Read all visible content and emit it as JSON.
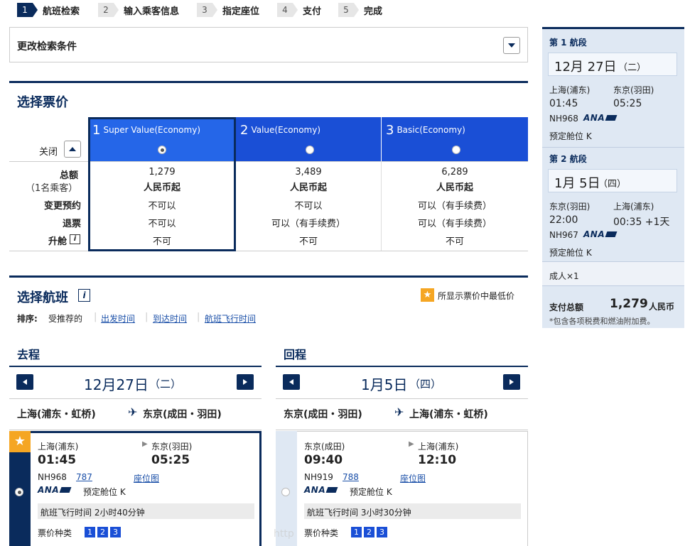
{
  "steps": [
    {
      "num": "1",
      "label": "航班检索"
    },
    {
      "num": "2",
      "label": "输入乘客信息"
    },
    {
      "num": "3",
      "label": "指定座位"
    },
    {
      "num": "4",
      "label": "支付"
    },
    {
      "num": "5",
      "label": "完成"
    }
  ],
  "modify": {
    "label": "更改检索条件"
  },
  "fare": {
    "title": "选择票价",
    "close_label": "关闭",
    "columns": [
      {
        "num": "1",
        "name": "Super Value(Economy)",
        "total": "1,279",
        "unit": "人民币起",
        "change": "不可以",
        "refund": "不可以",
        "upgrade": "不可"
      },
      {
        "num": "2",
        "name": "Value(Economy)",
        "total": "3,489",
        "unit": "人民币起",
        "change": "不可以",
        "refund": "可以（有手续费）",
        "upgrade": "不可"
      },
      {
        "num": "3",
        "name": "Basic(Economy)",
        "total": "6,289",
        "unit": "人民币起",
        "change": "可以（有手续费）",
        "refund": "可以（有手续费）",
        "upgrade": "不可"
      }
    ],
    "row_labels": {
      "total": "总额",
      "pax": "（1名乘客）",
      "change": "变更预约",
      "refund": "退票",
      "upgrade": "升舱"
    }
  },
  "flights": {
    "title": "选择航班",
    "lowest_note": "所显示票价中最低价",
    "sort_label": "排序:",
    "sort_current": "受推荐的",
    "sort_links": [
      "出发时间",
      "到达时间",
      "航班飞行时间"
    ],
    "outbound": {
      "heading": "去程",
      "date_day": "12月27日",
      "date_week": "（二）",
      "from": "上海(浦东・虹桥)",
      "to": "东京(成田・羽田)",
      "card": {
        "dep_city": "上海(浦东)",
        "arr_city": "东京(羽田)",
        "dep_time": "01:45",
        "arr_time": "05:25",
        "flight": "NH968",
        "aircraft": "787",
        "seatmap": "座位图",
        "airline": "ANA",
        "class": "预定舱位 K",
        "duration": "航班飞行时间 2小时40分钟",
        "fare_type_label": "票价种类",
        "fare_tabs": [
          "1",
          "2",
          "3"
        ]
      }
    },
    "return": {
      "heading": "回程",
      "date_day": "1月5日",
      "date_week": "（四）",
      "from": "东京(成田・羽田)",
      "to": "上海(浦东・虹桥)",
      "card": {
        "dep_city": "东京(成田)",
        "arr_city": "上海(浦东)",
        "dep_time": "09:40",
        "arr_time": "12:10",
        "flight": "NH919",
        "aircraft": "788",
        "seatmap": "座位图",
        "airline": "ANA",
        "class": "预定舱位 K",
        "duration": "航班飞行时间 3小时30分钟",
        "fare_type_label": "票价种类",
        "fare_tabs": [
          "1",
          "2",
          "3"
        ]
      }
    }
  },
  "sidebar": {
    "seg1": {
      "title": "第 1 航段",
      "date": "12月 27日",
      "week": "（二）",
      "dep_city": "上海(浦东)",
      "arr_city": "东京(羽田)",
      "dep_time": "01:45",
      "arr_time": "05:25",
      "flight": "NH968",
      "airline": "ANA",
      "class": "预定舱位 K"
    },
    "seg2": {
      "title": "第 2 航段",
      "date": "1月 5日",
      "week": "（四）",
      "dep_city": "东京(羽田)",
      "arr_city": "上海(浦东)",
      "dep_time": "22:00",
      "arr_time": "00:35 +1天",
      "flight": "NH967",
      "airline": "ANA",
      "class": "预定舱位 K"
    },
    "pax": "成人×1",
    "total_label": "支付总额",
    "total_value": "1,279",
    "total_unit": "人民币",
    "note": "*包含各项税费和燃油附加费。"
  },
  "watermark": "http",
  "colors": {
    "navy": "#0a2b5c",
    "blue": "#1a4fd6",
    "orange": "#f5a623",
    "sidebar": "#dfe8f3"
  }
}
